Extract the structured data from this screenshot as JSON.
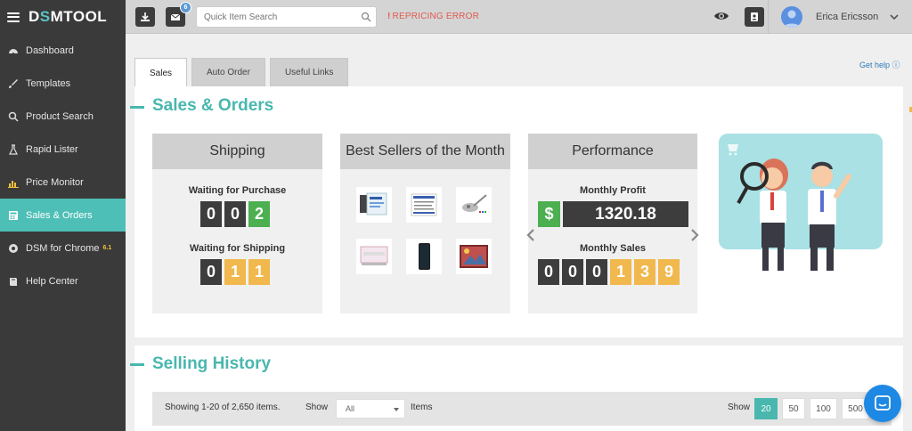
{
  "app": {
    "logo_part1": "D",
    "logo_accent": "S",
    "logo_part2": "MTOOL"
  },
  "sidebar": {
    "items": [
      {
        "label": "Dashboard",
        "icon": "dashboard-icon"
      },
      {
        "label": "Templates",
        "icon": "brush-icon"
      },
      {
        "label": "Product Search",
        "icon": "search-icon"
      },
      {
        "label": "Rapid Lister",
        "icon": "flask-icon"
      },
      {
        "label": "Price Monitor",
        "icon": "bar-chart-icon"
      },
      {
        "label": "Sales & Orders",
        "icon": "calculator-icon",
        "active": true
      },
      {
        "label": "DSM for Chrome",
        "icon": "chrome-icon",
        "badge": "6.1"
      },
      {
        "label": "Help Center",
        "icon": "book-icon"
      }
    ]
  },
  "topbar": {
    "notification_count": "6",
    "search_placeholder": "Quick Item Search",
    "error_mark": "!",
    "error_text": "REPRICING ERROR",
    "username": "Erica Ericsson"
  },
  "tabs": [
    "Sales",
    "Auto Order",
    "Useful Links"
  ],
  "help_link": "Get help",
  "sales_orders": {
    "title": "Sales & Orders",
    "shipping": {
      "title": "Shipping",
      "waiting_purchase_label": "Waiting for Purchase",
      "waiting_purchase_digits": [
        "0",
        "0",
        "2"
      ],
      "waiting_shipping_label": "Waiting for Shipping",
      "waiting_shipping_digits": [
        "0",
        "1",
        "1"
      ]
    },
    "best_sellers": {
      "title": "Best Sellers of the Month"
    },
    "performance": {
      "title": "Performance",
      "profit_label": "Monthly Profit",
      "currency": "$",
      "profit_value": "1320.18",
      "sales_label": "Monthly Sales",
      "sales_digits": [
        "0",
        "0",
        "0",
        "1",
        "3",
        "9"
      ]
    }
  },
  "selling_history": {
    "title": "Selling History",
    "showing": "Showing 1-20 of 2,650 items.",
    "show_label": "Show",
    "filter_value": "All",
    "items_label": "Items",
    "page_size_label": "Show",
    "page_sizes": [
      "20",
      "50",
      "100",
      "500"
    ],
    "selected_page_size": "20"
  },
  "colors": {
    "accent": "#49b7ae",
    "sidebar": "#3a3a3a",
    "error": "#e05a4e",
    "digit_dark": "#3d3d3d",
    "digit_green": "#4caf50",
    "digit_orange": "#f1b84d"
  }
}
